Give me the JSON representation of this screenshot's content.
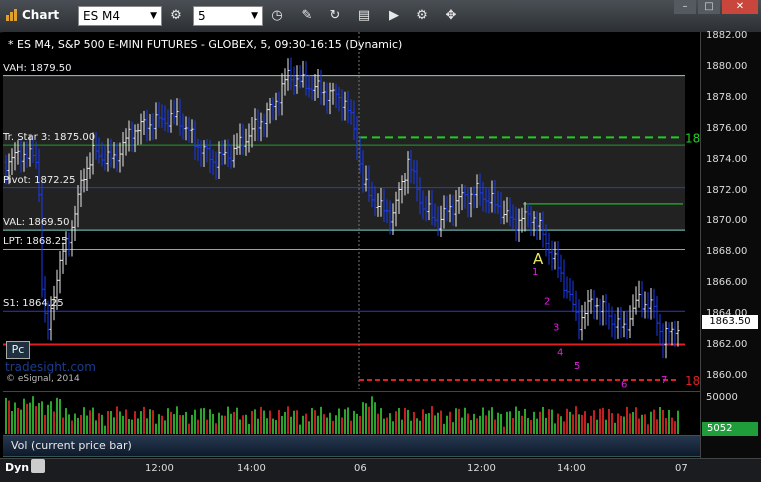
{
  "app": {
    "title": "Chart"
  },
  "toolbar": {
    "symbol": "ES M4",
    "interval": "5",
    "tools": [
      "clock-icon",
      "pencil-icon",
      "cycle-icon",
      "study-icon",
      "play-icon",
      "crosshair-icon"
    ]
  },
  "chart": {
    "title": "* ES M4, S&P 500 E-MINI FUTURES - GLOBEX, 5, 09:30-16:15 (Dynamic)",
    "levels": [
      {
        "label": "VAH: 1879.50",
        "price": 1879.5,
        "color": "#7fd6d0"
      },
      {
        "label": "Tr. Star 3: 1875.00",
        "price": 1875.0,
        "color": "#1e9e2a"
      },
      {
        "label": "Pivot: 1872.25",
        "price": 1872.25,
        "color": "#2a3cc8"
      },
      {
        "label": "VAL: 1869.50",
        "price": 1869.5,
        "color": "#7fd6d0"
      },
      {
        "label": "LPT: 1868.25",
        "price": 1868.25,
        "color": "#9aa0a8"
      },
      {
        "label": "S1: 1864.25",
        "price": 1864.25,
        "color": "#2a3cc8"
      }
    ],
    "price_ticks": [
      "1882.00",
      "1880.00",
      "1878.00",
      "1876.00",
      "1874.00",
      "1872.00",
      "1870.00",
      "1868.00",
      "1866.00",
      "1864.00",
      "1862.00",
      "1860.00"
    ],
    "current_price": "1863.50",
    "markers_right": {
      "upper": "18",
      "lower": "18"
    },
    "annotation_A": "A",
    "count_labels": [
      "1",
      "2",
      "3",
      "4",
      "5",
      "6",
      "7"
    ],
    "pc_button": "Pc",
    "watermark": "tradesight.com",
    "copyright": "© eSignal, 2014"
  },
  "volume": {
    "label": "Vol (current price bar)",
    "tick": "50000",
    "current": "5052"
  },
  "time_axis": {
    "dyn_label": "Dyn",
    "ticks": [
      "12:00",
      "14:00",
      "06",
      "12:00",
      "14:00",
      "07"
    ]
  },
  "colors": {
    "up": "#e8e8e8",
    "down": "#1a3cf0",
    "target_green": "#22cc22",
    "target_red": "#e02020",
    "count_magenta": "#e020e0"
  }
}
